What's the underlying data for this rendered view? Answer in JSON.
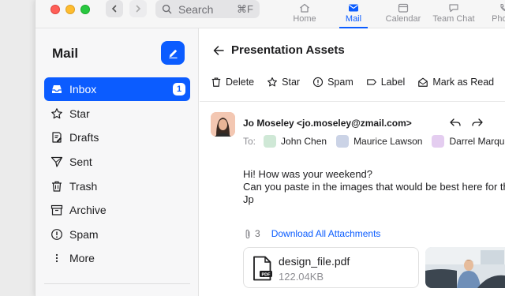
{
  "toolbar_top": {
    "search_placeholder": "Search",
    "search_shortcut": "⌘F",
    "app_tabs": [
      {
        "label": "Home",
        "icon": "home-icon"
      },
      {
        "label": "Mail",
        "icon": "mail-icon",
        "active": true
      },
      {
        "label": "Calendar",
        "icon": "calendar-icon"
      },
      {
        "label": "Team Chat",
        "icon": "chat-icon"
      },
      {
        "label": "Phone",
        "icon": "phone-icon"
      }
    ]
  },
  "sidebar": {
    "title": "Mail",
    "items": [
      {
        "label": "Inbox",
        "icon": "inbox-icon",
        "badge": "1",
        "active": true
      },
      {
        "label": "Star",
        "icon": "star-icon"
      },
      {
        "label": "Drafts",
        "icon": "drafts-icon"
      },
      {
        "label": "Sent",
        "icon": "sent-icon"
      },
      {
        "label": "Trash",
        "icon": "trash-icon"
      },
      {
        "label": "Archive",
        "icon": "archive-icon"
      },
      {
        "label": "Spam",
        "icon": "spam-icon"
      },
      {
        "label": "More",
        "icon": "more-vertical-icon"
      }
    ]
  },
  "message": {
    "subject": "Presentation Assets",
    "actions": [
      {
        "label": "Delete",
        "icon": "trash-icon"
      },
      {
        "label": "Star",
        "icon": "star-icon"
      },
      {
        "label": "Spam",
        "icon": "spam-icon"
      },
      {
        "label": "Label",
        "icon": "label-icon"
      },
      {
        "label": "Mark as Read",
        "icon": "mark-read-icon"
      }
    ],
    "more_label": "•••",
    "from": "Jo Moseley <jo.moseley@zmail.com>",
    "to_label": "To:",
    "recipients": [
      "John Chen",
      "Maurice Lawson",
      "Darrel Marquez"
    ],
    "body_lines": [
      "Hi! How was your weekend?",
      "Can you paste in the images that would be best here for the presentation?",
      "Jp"
    ],
    "attachment_count": "3",
    "download_all": "Download All Attachments",
    "file": {
      "name": "design_file.pdf",
      "size": "122.04KB",
      "badge": "PDF"
    }
  },
  "colors": {
    "accent": "#0b5cff",
    "sidebar_bg": "#f7f7f8",
    "titlebar_bg": "#f6f6f6"
  }
}
